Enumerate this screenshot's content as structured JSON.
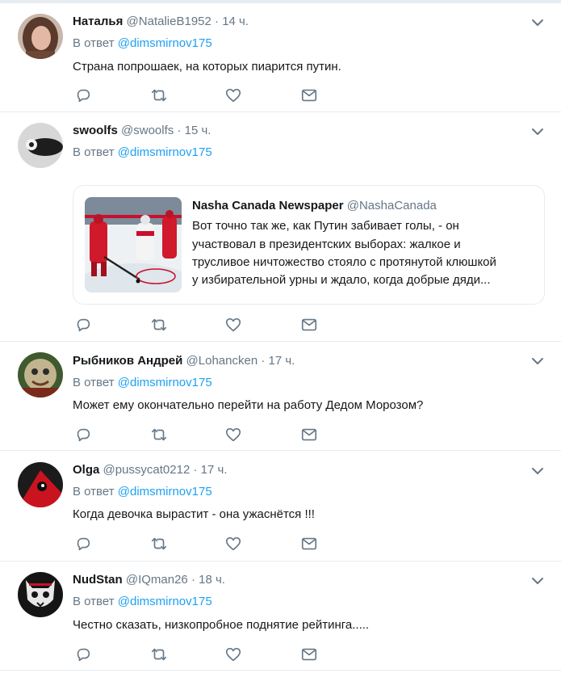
{
  "reply_prefix": "В ответ",
  "tweets": [
    {
      "name": "Наталья",
      "handle": "@NatalieB1952",
      "separator": "·",
      "time": "14 ч.",
      "mention": "@dimsmirnov175",
      "text": "Страна попрошаек, на которых пиарится путин."
    },
    {
      "name": "swoolfs",
      "handle": "@swoolfs",
      "separator": "·",
      "time": "15 ч.",
      "mention": "@dimsmirnov175",
      "text": "",
      "quote": {
        "name": "Nasha Canada Newspaper",
        "handle": "@NashaCanada",
        "lines": [
          "Вот точно так же, как Путин забивает голы, - он",
          "участвовал в президентских выборах: жалкое и",
          "трусливое ничтожество стояло с протянутой клюшкой",
          "у избирательной урны и ждало, когда добрые дяди..."
        ]
      }
    },
    {
      "name": "Рыбников Андрей",
      "handle": "@Lohancken",
      "separator": "·",
      "time": "17 ч.",
      "mention": "@dimsmirnov175",
      "text": "Может ему окончательно перейти на работу Дедом Морозом?"
    },
    {
      "name": "Olga",
      "handle": "@pussycat0212",
      "separator": "·",
      "time": "17 ч.",
      "mention": "@dimsmirnov175",
      "text": "Когда девочка вырастит - она ужаснётся !!!"
    },
    {
      "name": "NudStan",
      "handle": "@IQman26",
      "separator": "·",
      "time": "18 ч.",
      "mention": "@dimsmirnov175",
      "text": "Честно сказать, низкопробное поднятие рейтинга....."
    }
  ],
  "icons": {
    "reply": "reply-icon",
    "retweet": "retweet-icon",
    "like": "heart-icon",
    "message": "envelope-icon",
    "menu": "chevron-down-icon"
  },
  "colors": {
    "link": "#1da1f2",
    "secondary": "#657786",
    "border": "#e6ecf0",
    "text": "#14171a"
  }
}
